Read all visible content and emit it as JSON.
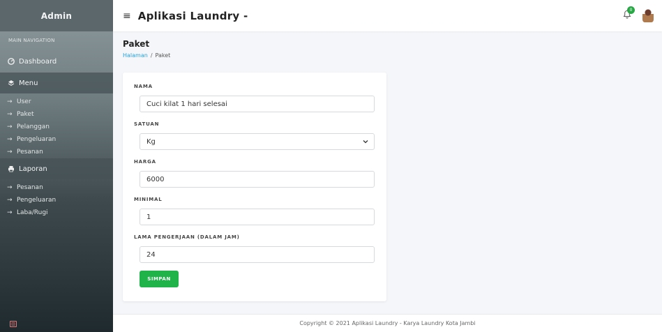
{
  "sidebar": {
    "brand": "Admin",
    "nav_header": "MAIN NAVIGATION",
    "dashboard": "Dashboard",
    "menu": {
      "label": "Menu",
      "items": [
        "User",
        "Paket",
        "Pelanggan",
        "Pengeluaran",
        "Pesanan"
      ]
    },
    "laporan": {
      "label": "Laporan",
      "items": [
        "Pesanan",
        "Pengeluaran",
        "Laba/Rugi"
      ]
    }
  },
  "topbar": {
    "title": "Aplikasi Laundry -",
    "notification_count": "0"
  },
  "page": {
    "title": "Paket",
    "breadcrumb_home": "Halaman",
    "breadcrumb_current": "Paket"
  },
  "form": {
    "nama": {
      "label": "NAMA",
      "value": "Cuci kilat 1 hari selesai"
    },
    "satuan": {
      "label": "SATUAN",
      "value": "Kg"
    },
    "harga": {
      "label": "HARGA",
      "value": "6000"
    },
    "minimal": {
      "label": "MINIMAL",
      "value": "1"
    },
    "lama": {
      "label": "LAMA PENGERJAAN (DALAM JAM)",
      "value": "24"
    },
    "submit_label": "SIMPAN"
  },
  "footer": {
    "text": "Copyright © 2021 Aplikasi Laundry - Karya Laundry Kota Jambi"
  },
  "icons": {
    "menu": "hamburger-icon",
    "dashboard": "dashboard-icon",
    "section": "layers-icon",
    "printer": "printer-icon",
    "bell": "bell-icon"
  },
  "colors": {
    "accent_green": "#20b34a",
    "link_blue": "#28a0d8"
  }
}
